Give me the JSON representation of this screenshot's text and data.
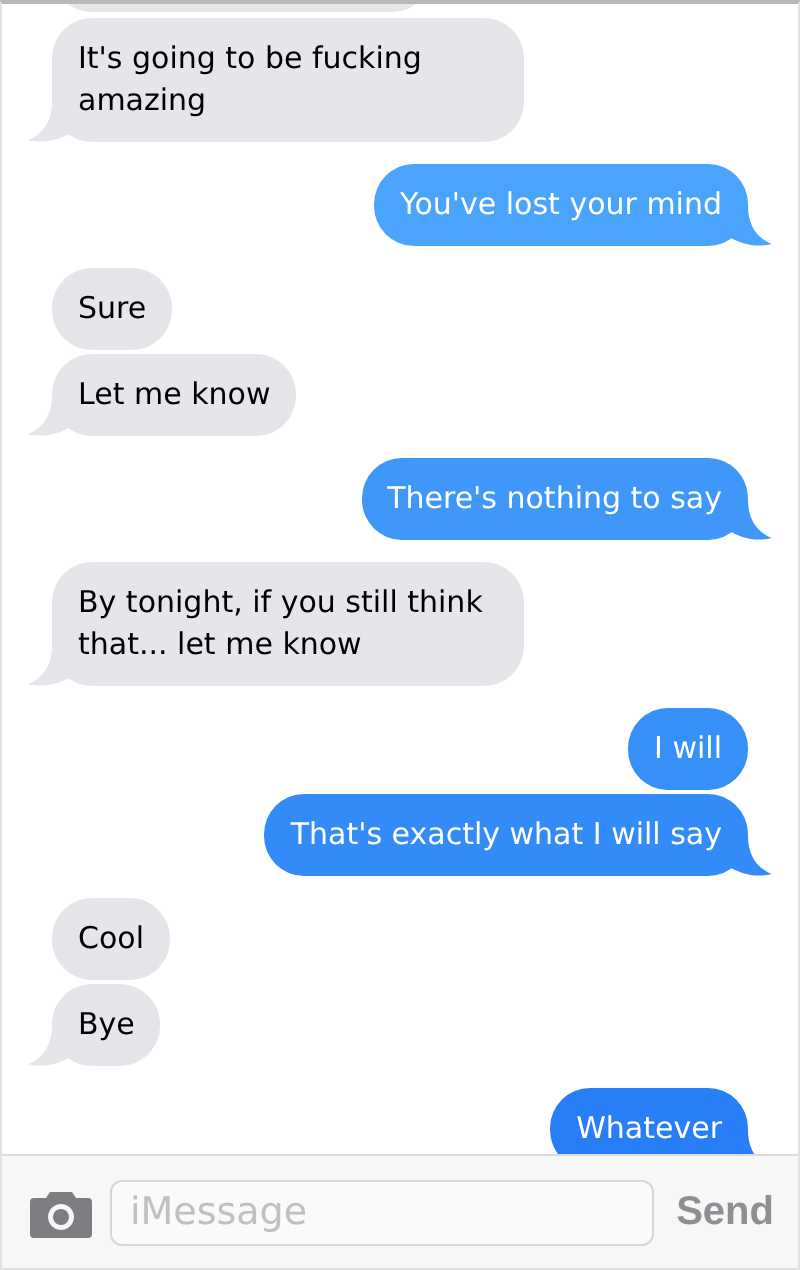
{
  "messages": [
    {
      "kind": "cutoff"
    },
    {
      "kind": "received",
      "text": "It's going to be fucking amazing"
    },
    {
      "kind": "sent",
      "text": "You've lost your mind"
    },
    {
      "kind": "received",
      "text": "Sure"
    },
    {
      "kind": "received",
      "text": "Let me know"
    },
    {
      "kind": "sent",
      "text": "There's nothing to say"
    },
    {
      "kind": "received",
      "text": "By tonight, if you still think that... let me know"
    },
    {
      "kind": "sent",
      "text": "I will"
    },
    {
      "kind": "sent",
      "text": "That's exactly what I will say"
    },
    {
      "kind": "received",
      "text": "Cool"
    },
    {
      "kind": "received",
      "text": "Bye"
    },
    {
      "kind": "sent",
      "text": "Whatever"
    }
  ],
  "composer": {
    "placeholder": "iMessage",
    "send": "Send"
  }
}
